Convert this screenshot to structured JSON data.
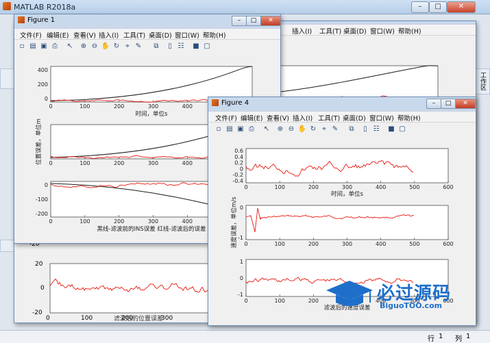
{
  "app": {
    "title": "MATLAB R2018a",
    "status_row_label": "行",
    "status_row_value": "1",
    "status_col_label": "列",
    "status_col_value": "1",
    "right_panel_label": "工作区"
  },
  "figure1": {
    "title": "Figure 1",
    "menu": [
      "文件(F)",
      "编辑(E)",
      "查看(V)",
      "插入(I)",
      "工具(T)",
      "桌面(D)",
      "窗口(W)",
      "帮助(H)"
    ],
    "plots": [
      {
        "yticks": [
          "400",
          "200",
          "0"
        ],
        "xticks": [
          "0",
          "100",
          "200",
          "300",
          "400"
        ],
        "xlabel": "时间，单位s",
        "ylabel": ""
      },
      {
        "yticks": [],
        "xticks": [
          "0",
          "100",
          "200",
          "300",
          "400"
        ],
        "xlabel": "",
        "ylabel": "位置误差，单位m"
      },
      {
        "yticks": [
          "0",
          "-100",
          "-200"
        ],
        "xticks": [
          "0",
          "100",
          "200",
          "300",
          "400"
        ],
        "xlabel": "黑线-滤波前的INS误差  红线-滤波后的误差",
        "ylabel": ""
      }
    ]
  },
  "figure_behind": {
    "menu": [
      "插入(I)",
      "工具(T)",
      "桌面(D)",
      "窗口(W)",
      "帮助(H)"
    ],
    "lower_yticks": [
      "20",
      "0",
      "-20"
    ],
    "lower_xticks": [
      "0",
      "100",
      "200",
      "300"
    ],
    "lower_xlabel": "滤波后的位置误差",
    "partial_tick": "-20"
  },
  "figure4": {
    "title": "Figure 4",
    "menu": [
      "文件(F)",
      "编辑(E)",
      "查看(V)",
      "插入(I)",
      "工具(T)",
      "桌面(D)",
      "窗口(W)",
      "帮助(H)"
    ],
    "plots": [
      {
        "yticks": [
          "0.6",
          "0.4",
          "0.2",
          "0",
          "-0.2",
          "-0.4"
        ],
        "xticks": [
          "0",
          "100",
          "200",
          "300",
          "400",
          "500",
          "600"
        ],
        "xlabel": "时间，单位s",
        "ylabel": ""
      },
      {
        "yticks": [
          "0",
          "-1"
        ],
        "xticks": [
          "0",
          "100",
          "200",
          "300",
          "400",
          "500",
          "600"
        ],
        "xlabel": "",
        "ylabel": "速度误差，单位m/s"
      },
      {
        "yticks": [
          "1",
          "0",
          "-1"
        ],
        "xticks": [
          "0",
          "100",
          "200",
          "300",
          "400",
          "500",
          "600"
        ],
        "xlabel": "滤波后的速度误差",
        "ylabel": ""
      }
    ]
  },
  "watermark": {
    "text": "必过源码",
    "url": "BiguoTOO.com"
  },
  "colors": {
    "series_black": "#1a1a1a",
    "series_red": "#e8170f",
    "axes_bg": "#ffffff",
    "figure_bg": "#f0f0f0"
  }
}
